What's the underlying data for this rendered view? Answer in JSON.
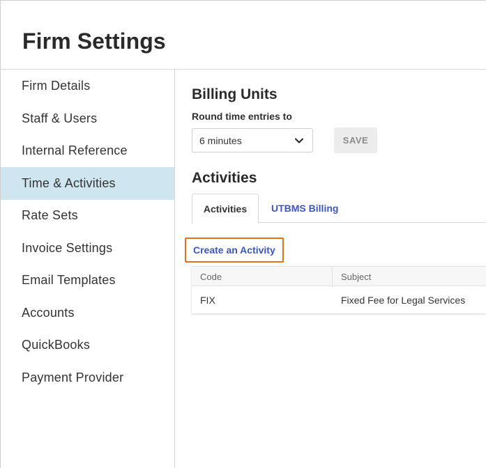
{
  "header": {
    "title": "Firm Settings"
  },
  "sidebar": {
    "items": [
      {
        "label": "Firm Details"
      },
      {
        "label": "Staff & Users"
      },
      {
        "label": "Internal Reference"
      },
      {
        "label": "Time & Activities",
        "active": true
      },
      {
        "label": "Rate Sets"
      },
      {
        "label": "Invoice Settings"
      },
      {
        "label": "Email Templates"
      },
      {
        "label": "Accounts"
      },
      {
        "label": "QuickBooks"
      },
      {
        "label": "Payment Provider"
      }
    ]
  },
  "billing_units": {
    "title": "Billing Units",
    "round_label": "Round time entries to",
    "round_value": "6 minutes",
    "save_label": "SAVE"
  },
  "activities": {
    "title": "Activities",
    "tabs": [
      {
        "label": "Activities",
        "active": true
      },
      {
        "label": "UTBMS Billing"
      }
    ],
    "create_label": "Create an Activity",
    "table": {
      "columns": [
        "Code",
        "Subject"
      ],
      "rows": [
        {
          "code": "FIX",
          "subject": "Fixed Fee for Legal Services"
        }
      ]
    }
  },
  "icons": {
    "select_arrow": "chevron-down-icon"
  },
  "colors": {
    "accent_link": "#3b55c4",
    "active_nav": "#cfe6f1",
    "highlight_outline": "#e1701f"
  }
}
